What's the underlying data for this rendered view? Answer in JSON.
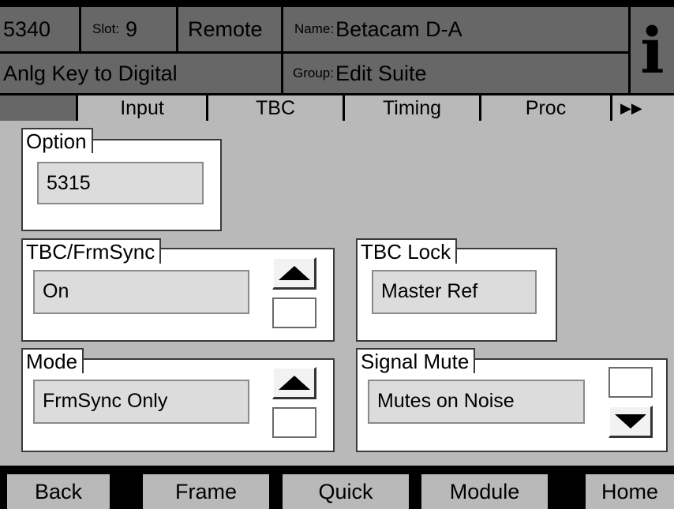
{
  "header": {
    "model": "5340",
    "slot_label": "Slot:",
    "slot_value": "9",
    "mode": "Remote",
    "name_label": "Name:",
    "name_value": "Betacam D-A",
    "subtitle": "Anlg Key to Digital",
    "group_label": "Group:",
    "group_value": "Edit Suite",
    "info_icon": "i"
  },
  "tabs": [
    {
      "label": "Input"
    },
    {
      "label": "TBC"
    },
    {
      "label": "Timing"
    },
    {
      "label": "Proc"
    },
    {
      "label": "▶▶"
    }
  ],
  "panels": {
    "option": {
      "legend": "Option",
      "value": "5315"
    },
    "tbc_frmsync": {
      "legend": "TBC/FrmSync",
      "value": "On"
    },
    "tbc_lock": {
      "legend": "TBC Lock",
      "value": "Master Ref"
    },
    "mode": {
      "legend": "Mode",
      "value": "FrmSync Only"
    },
    "signal_mute": {
      "legend": "Signal Mute",
      "value": "Mutes on Noise"
    }
  },
  "icons": {
    "up": "up-arrow-icon",
    "down": "down-arrow-icon",
    "info": "info-icon"
  },
  "footer": {
    "back": "Back",
    "frame": "Frame",
    "quick": "Quick",
    "module": "Module",
    "home": "Home"
  },
  "colors": {
    "header_bg": "#676767",
    "panel_bg": "#b9b9b9",
    "field_bg": "#dcdcdc"
  }
}
